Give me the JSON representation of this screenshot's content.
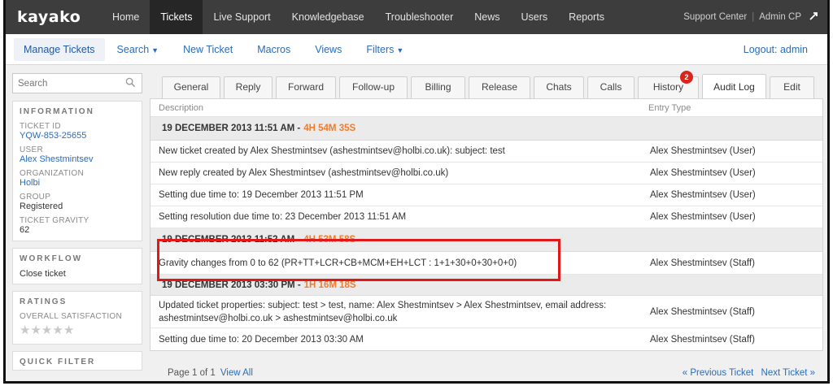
{
  "topnav": {
    "logo": "kayako",
    "items": [
      "Home",
      "Tickets",
      "Live Support",
      "Knowledgebase",
      "Troubleshooter",
      "News",
      "Users",
      "Reports"
    ],
    "active_index": 1,
    "support_center": "Support Center",
    "separator": "|",
    "admin_cp": "Admin CP"
  },
  "subnav": {
    "manage_tickets": "Manage Tickets",
    "search": "Search",
    "new_ticket": "New Ticket",
    "macros": "Macros",
    "views": "Views",
    "filters": "Filters",
    "logout": "Logout: admin"
  },
  "sidebar": {
    "search_placeholder": "Search",
    "information_head": "INFORMATION",
    "ticket_id_label": "TICKET ID",
    "ticket_id": "YQW-853-25655",
    "user_label": "USER",
    "user": "Alex Shestmintsev",
    "organization_label": "ORGANIZATION",
    "organization": "Holbi",
    "group_label": "GROUP",
    "group": "Registered",
    "gravity_label": "TICKET GRAVITY",
    "gravity": "62",
    "workflow_head": "WORKFLOW",
    "close_ticket": "Close ticket",
    "ratings_head": "RATINGS",
    "overall_satisfaction": "OVERALL SATISFACTION",
    "quick_filter_head": "QUICK FILTER"
  },
  "tabs": [
    {
      "label": "General"
    },
    {
      "label": "Reply"
    },
    {
      "label": "Forward"
    },
    {
      "label": "Follow-up"
    },
    {
      "label": "Billing"
    },
    {
      "label": "Release"
    },
    {
      "label": "Chats"
    },
    {
      "label": "Calls"
    },
    {
      "label": "History",
      "badge": "2"
    },
    {
      "label": "Audit Log"
    },
    {
      "label": "Edit"
    }
  ],
  "audit": {
    "col_description": "Description",
    "col_entry_type": "Entry Type",
    "group1": {
      "date": "19 DECEMBER 2013 11:51 AM - ",
      "elapsed": "4H 54M 35S"
    },
    "group2": {
      "date": "19 DECEMBER 2013 11:52 AM - ",
      "elapsed": "4H 53M 58S"
    },
    "group3": {
      "date": "19 DECEMBER 2013 03:30 PM - ",
      "elapsed": "1H 16M 18S"
    },
    "rows": [
      {
        "description": "New ticket created by Alex Shestmintsev (ashestmintsev@holbi.co.uk): subject: test",
        "entry_type": "Alex Shestmintsev (User)"
      },
      {
        "description": "New reply created by Alex Shestmintsev (ashestmintsev@holbi.co.uk)",
        "entry_type": "Alex Shestmintsev (User)"
      },
      {
        "description": "Setting due time to: 19 December 2013 11:51 PM",
        "entry_type": "Alex Shestmintsev (User)"
      },
      {
        "description": "Setting resolution due time to: 23 December 2013 11:51 AM",
        "entry_type": "Alex Shestmintsev (User)"
      },
      {
        "description": "Gravity changes from 0 to 62 (PR+TT+LCR+CB+MCM+EH+LCT : 1+1+30+0+30+0+0)",
        "entry_type": "Alex Shestmintsev (Staff)"
      },
      {
        "description": "Updated ticket properties: subject: test > test, name: Alex Shestmintsev > Alex Shestmintsev, email address: ashestmintsev@holbi.co.uk > ashestmintsev@holbi.co.uk",
        "entry_type": "Alex Shestmintsev (Staff)"
      },
      {
        "description": "Setting due time to: 20 December 2013 03:30 AM",
        "entry_type": "Alex Shestmintsev (Staff)"
      }
    ]
  },
  "footer": {
    "page": "Page 1 of 1",
    "view_all": "View All",
    "prev_ticket": "« Previous Ticket",
    "next_ticket": "Next Ticket »"
  },
  "colors": {
    "topnav_bg": "#3d3d3d",
    "link": "#2a6cb8",
    "elapsed_orange": "#f07b2c",
    "highlight_red": "#e01818",
    "badge_red": "#d9261c"
  }
}
